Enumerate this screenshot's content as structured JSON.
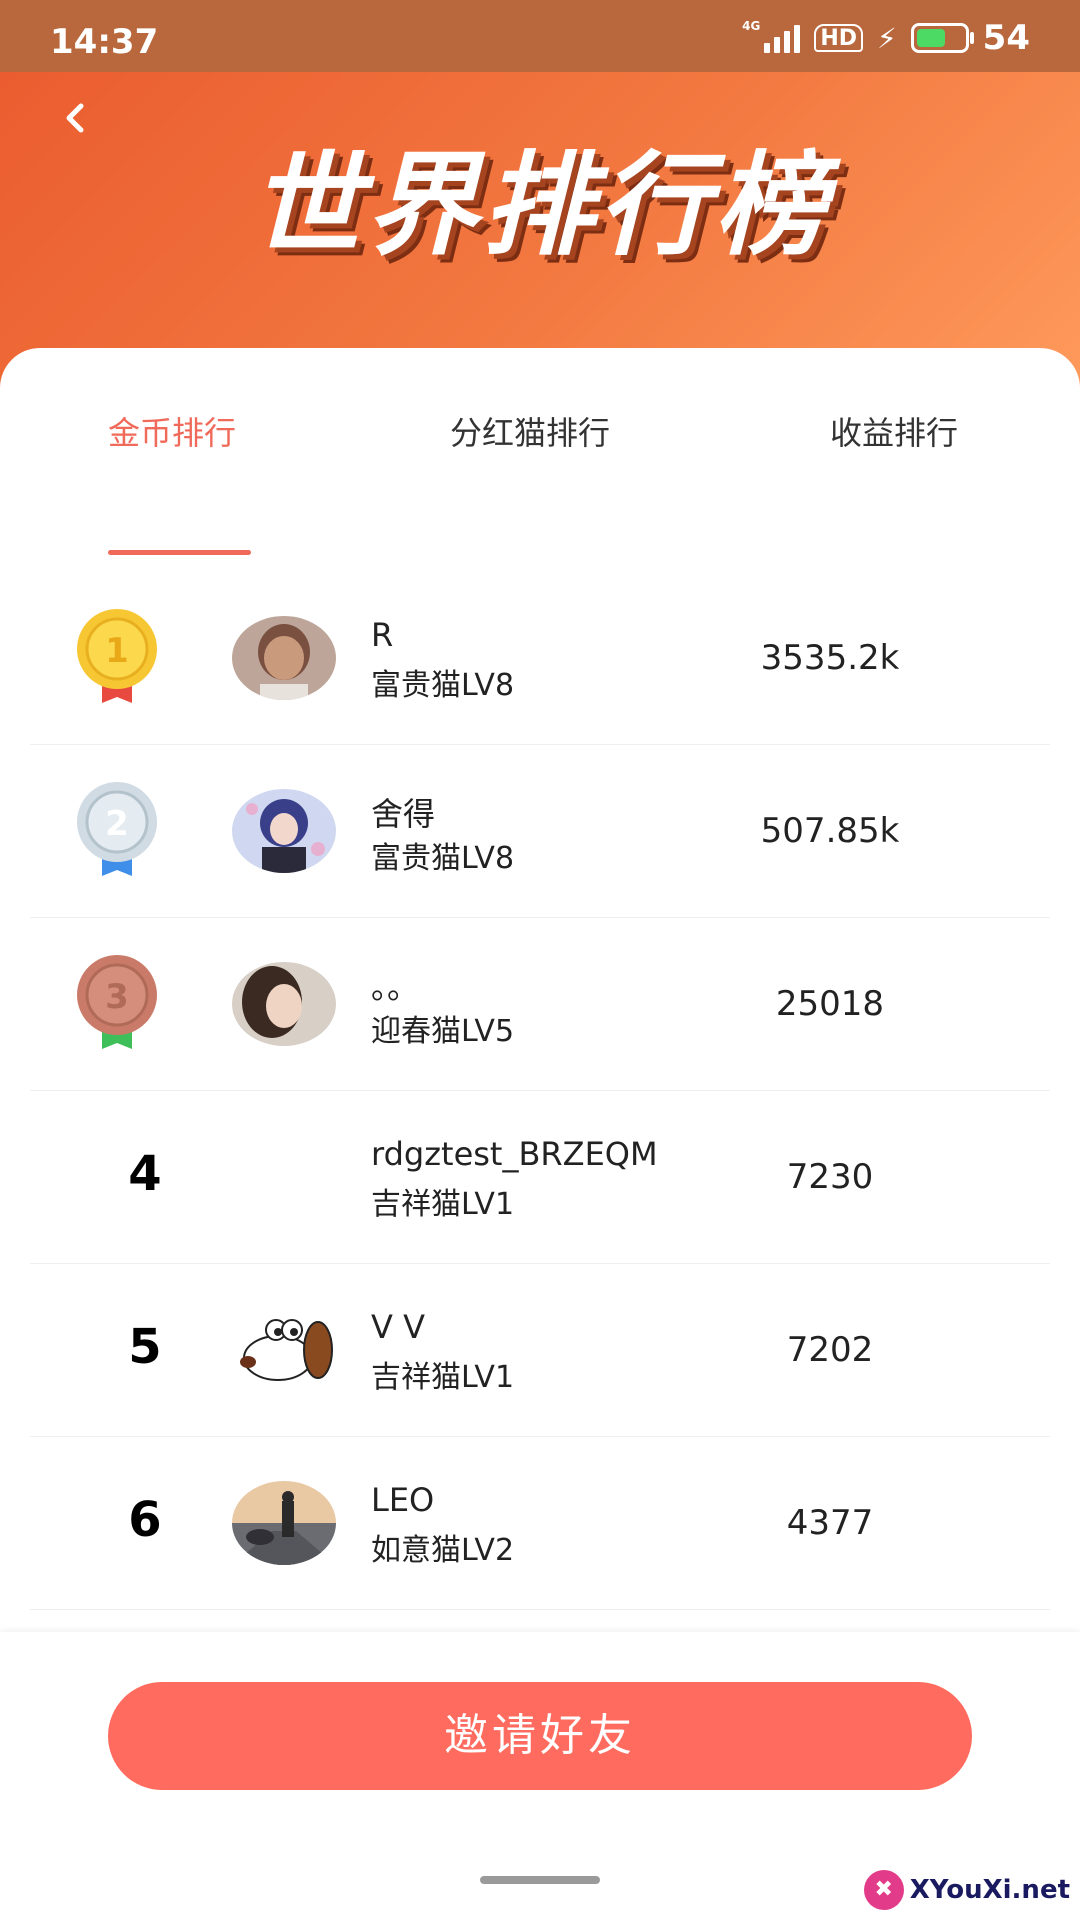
{
  "status_bar": {
    "time": "14:37",
    "network": "4G",
    "hd": "HD",
    "battery": "54",
    "battery_level_fraction": 0.54
  },
  "header": {
    "back_icon": "chevron-left-icon",
    "title": "世界排行榜",
    "gradient_colors": [
      "#ea5a2e",
      "#ff9a5c"
    ]
  },
  "tabs": [
    {
      "label": "金币排行",
      "active": true
    },
    {
      "label": "分红猫排行",
      "active": false
    },
    {
      "label": "收益排行",
      "active": false
    }
  ],
  "accent_color": "#f06a5a",
  "rankings": [
    {
      "rank": "1",
      "medal": "gold-medal",
      "name": "R",
      "level": "富贵猫LV8",
      "score": "3535.2k"
    },
    {
      "rank": "2",
      "medal": "silver-medal",
      "name": "舍得",
      "level": "富贵猫LV8",
      "score": "507.85k"
    },
    {
      "rank": "3",
      "medal": "bronze-medal",
      "name": "。。",
      "level": "迎春猫LV5",
      "score": "25018"
    },
    {
      "rank": "4",
      "medal": null,
      "name": "rdgztest_BRZEQM",
      "level": "吉祥猫LV1",
      "score": "7230"
    },
    {
      "rank": "5",
      "medal": null,
      "name": "V V",
      "level": "吉祥猫LV1",
      "score": "7202"
    },
    {
      "rank": "6",
      "medal": null,
      "name": "LEO",
      "level": "如意猫LV2",
      "score": "4377"
    }
  ],
  "footer": {
    "invite_label": "邀请好友",
    "invite_color": "#ff6b5e"
  },
  "watermark": {
    "text": "XYouXi.net"
  }
}
